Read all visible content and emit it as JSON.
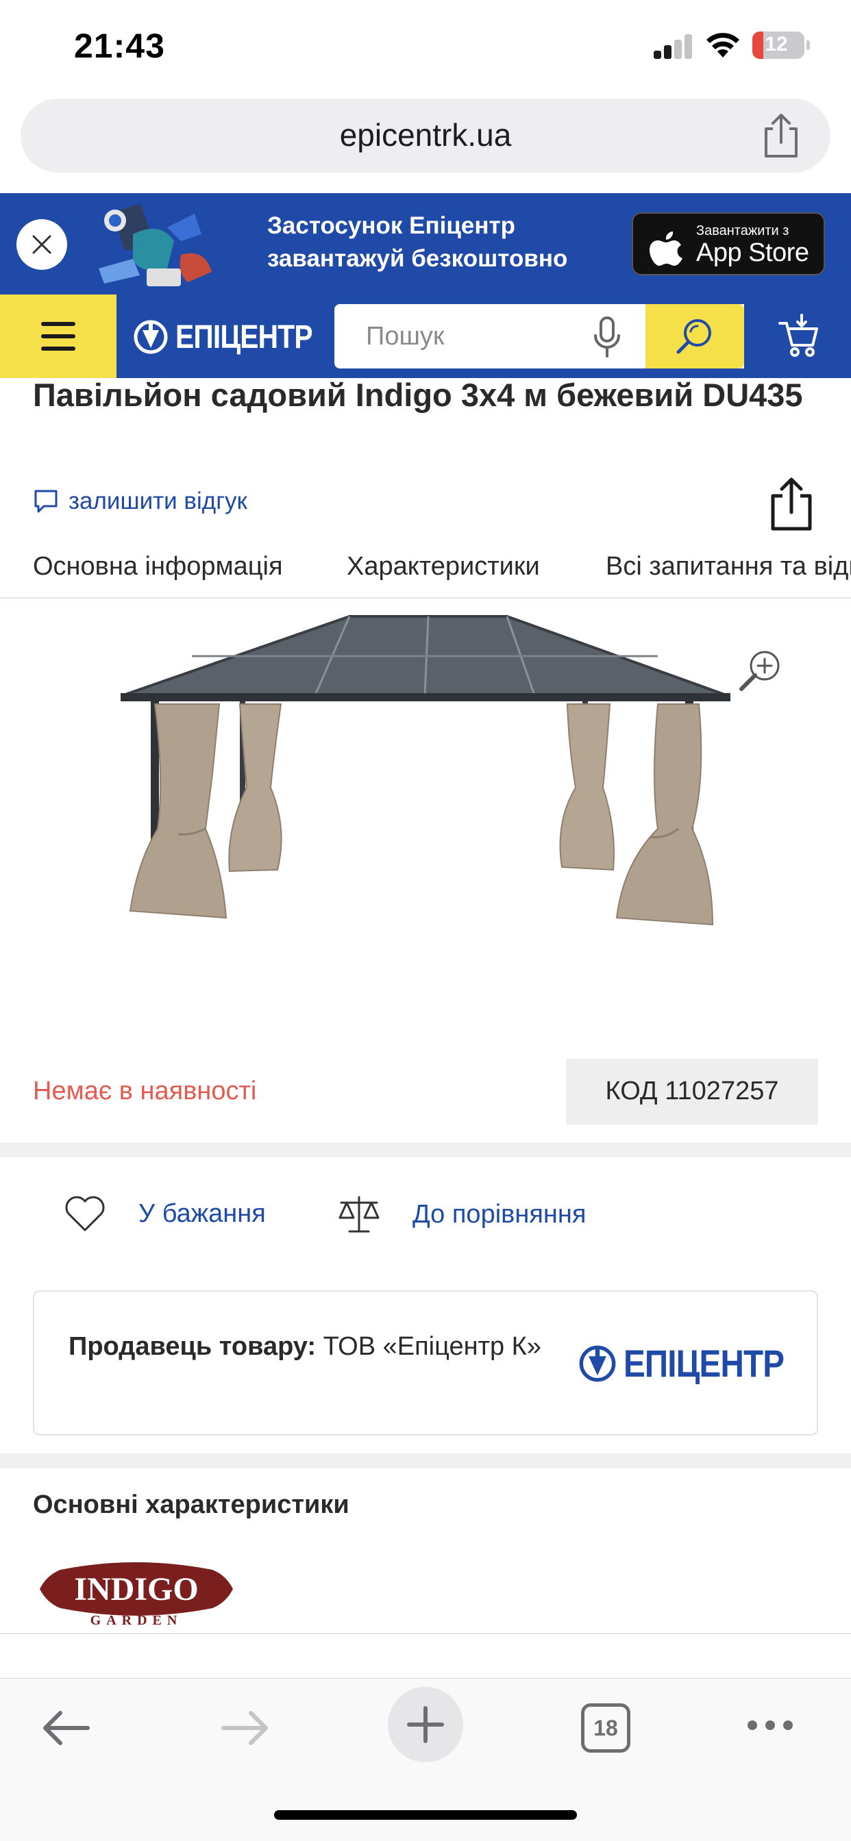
{
  "status_bar": {
    "time": "21:43",
    "battery": "12",
    "battery_color": "#e5483c"
  },
  "browser": {
    "url": "epicentrk.ua",
    "tab_count": "18",
    "icons": [
      "back-arrow-icon",
      "forward-arrow-icon",
      "plus-icon",
      "tabs-icon",
      "more-icon",
      "share-icon"
    ]
  },
  "app_banner": {
    "line1": "Застосунок Епіцентр",
    "line2": "завантажуй безкоштовно",
    "store_small": "Завантажити з",
    "store_big": "App Store"
  },
  "header": {
    "logo": "ЕПІЦЕНТР",
    "search_placeholder": "Пошук",
    "brand_blue": "#1f4aa8",
    "brand_yellow": "#f6e04a"
  },
  "product": {
    "title": "Павільйон садовий Indigo 3х4 м бежевий DU435",
    "review_link": "залишити відгук",
    "tabs": [
      "Основна інформація",
      "Характеристики",
      "Всі запитання та відгуки"
    ],
    "availability": "Немає в наявності",
    "availability_color": "#e45a4f",
    "code": "КОД 11027257",
    "wishlist": "У бажання",
    "compare": "До порівняння"
  },
  "seller": {
    "label": "Продавець товару:",
    "name": "ТОВ «Епіцентр К»",
    "logo": "ЕПІЦЕНТР"
  },
  "specs": {
    "title": "Основні характеристики",
    "brand_logo": "INDIGO",
    "brand_logo_sub": "GARDEN"
  }
}
